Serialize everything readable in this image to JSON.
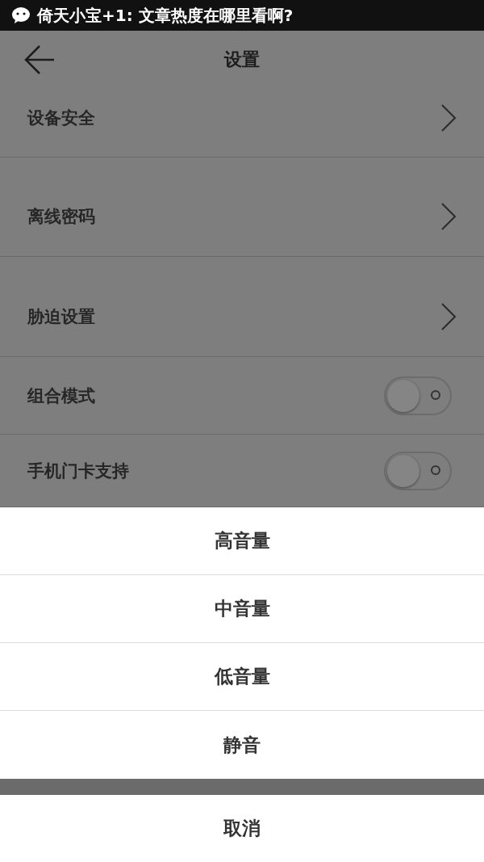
{
  "notification": {
    "text": "倚天小宝+1: 文章热度在哪里看啊?"
  },
  "header": {
    "title": "设置"
  },
  "settings": [
    {
      "label": "设备安全",
      "kind": "link"
    },
    {
      "label": "离线密码",
      "kind": "link"
    },
    {
      "label": "胁迫设置",
      "kind": "link"
    },
    {
      "label": "组合模式",
      "kind": "toggle",
      "on": false
    },
    {
      "label": "手机门卡支持",
      "kind": "toggle",
      "on": false
    }
  ],
  "action_sheet": {
    "options": [
      "高音量",
      "中音量",
      "低音量",
      "静音"
    ],
    "cancel": "取消"
  }
}
